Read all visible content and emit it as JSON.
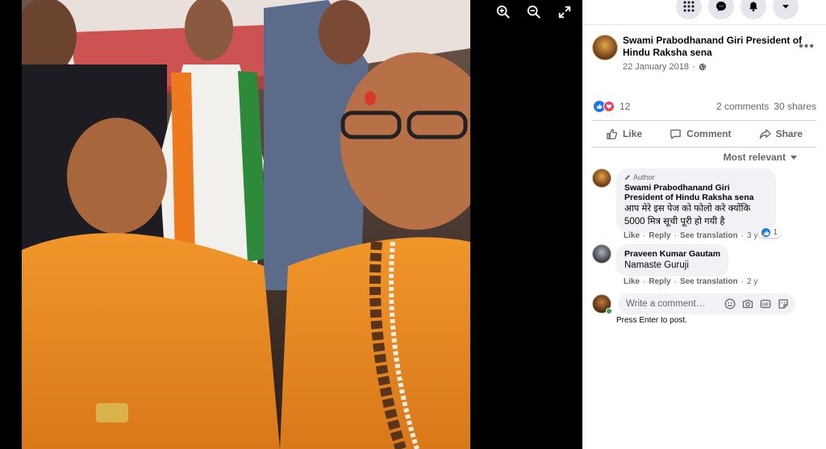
{
  "post": {
    "author": "Swami Prabodhanand Giri President of Hindu Raksha sena",
    "date": "22 January 2018",
    "reaction_count": "12",
    "comments_label": "2 comments",
    "shares_label": "30 shares"
  },
  "actions": {
    "like": "Like",
    "comment": "Comment",
    "share": "Share"
  },
  "sort": {
    "label": "Most relevant"
  },
  "comments": [
    {
      "author_tag": "Author",
      "name": "Swami Prabodhanand Giri President of Hindu Raksha sena",
      "text": "आप मेरे इस पेज को फोलो करे क्योंकि 5000 मित्र सूची पूरी हो गयी है",
      "reaction_count": "1",
      "like": "Like",
      "reply": "Reply",
      "translate": "See translation",
      "age": "3 y"
    },
    {
      "name": "Praveen Kumar Gautam",
      "text": "Namaste Guruji",
      "like": "Like",
      "reply": "Reply",
      "translate": "See translation",
      "age": "2 y"
    }
  ],
  "composer": {
    "placeholder": "Write a comment…",
    "hint": "Press Enter to post."
  },
  "colors": {
    "accent": "#1877f2",
    "love": "#f33e58",
    "panel_bg": "#ffffff",
    "bubble_bg": "#f0f2f5",
    "secondary_text": "#65676b"
  },
  "icons": [
    "zoom-in-icon",
    "zoom-out-icon",
    "fullscreen-icon",
    "grid-menu-icon",
    "messenger-icon",
    "bell-icon",
    "caret-down-icon",
    "globe-icon",
    "like-icon",
    "comment-icon",
    "share-icon",
    "pencil-icon",
    "emoji-icon",
    "camera-icon",
    "gif-icon",
    "sticker-icon"
  ]
}
